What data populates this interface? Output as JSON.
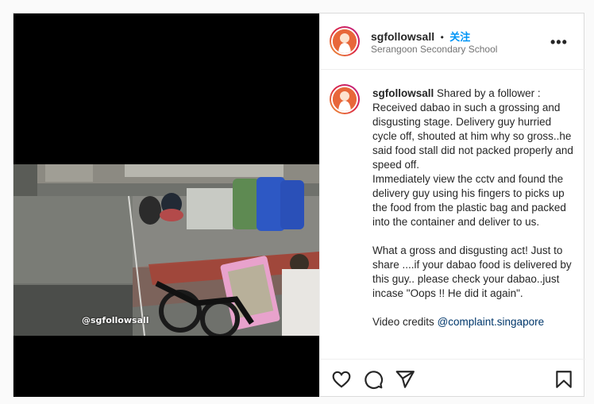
{
  "post": {
    "media": {
      "watermark": "@sgfollowsall"
    },
    "header": {
      "username": "sgfollowsall",
      "separator": "•",
      "follow_label": "关注",
      "location": "Serangoon Secondary School",
      "more_icon": "more-horizontal-icon"
    },
    "caption": {
      "username": "sgfollowsall",
      "text": " Shared by a follower : Received dabao in such a grossing and disgusting stage. Delivery guy hurried cycle off, shouted at him why so gross..he said food stall did not packed properly and speed off.\nImmediately view the cctv and found the delivery guy using his fingers to picks up the food from the plastic bag and packed into the container and deliver to us.\n\nWhat a gross and disgusting act! Just to share ....if your dabao food is delivered by this guy.. please check your dabao..just incase \"Oops !! He did it again\".\n\nVideo credits ",
      "credit_mention": "@complaint.singapore"
    },
    "actions": {
      "like_icon": "heart-icon",
      "comment_icon": "comment-icon",
      "share_icon": "send-icon",
      "save_icon": "bookmark-icon"
    }
  }
}
